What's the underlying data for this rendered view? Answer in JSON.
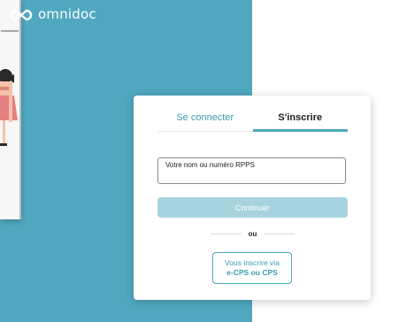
{
  "brand": {
    "name": "omnidoc",
    "accent_color": "#4fa8bf",
    "logo_icon": "infinity-logo-icon"
  },
  "auth": {
    "tabs": [
      {
        "label": "Se connecter",
        "active": false
      },
      {
        "label": "S'inscrire",
        "active": true
      }
    ],
    "input": {
      "placeholder": "Votre nom ou numéro RPPS",
      "value": ""
    },
    "continue_label": "Continuer",
    "divider_label": "ou",
    "cps_button": {
      "line1": "Vous inscrire via",
      "line2": "e-CPS ou CPS"
    }
  }
}
